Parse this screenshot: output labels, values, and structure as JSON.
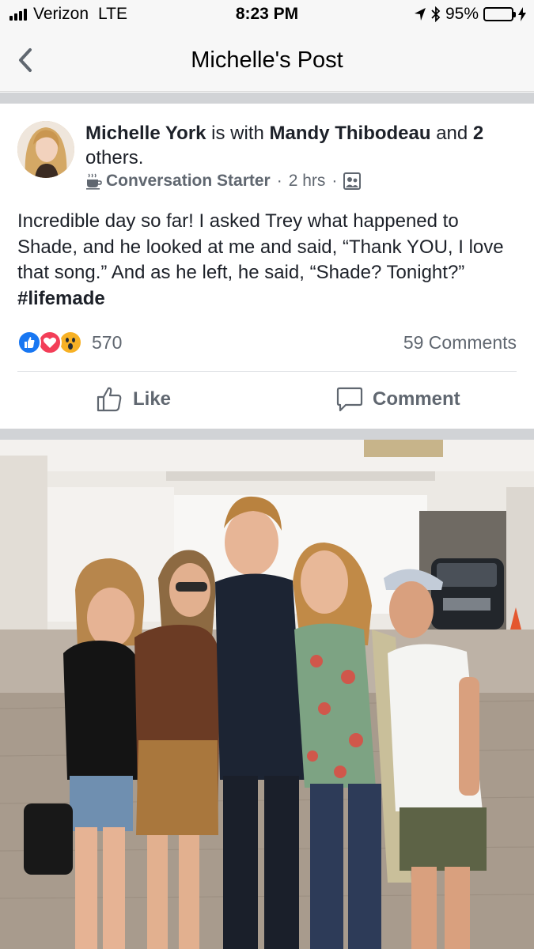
{
  "status_bar": {
    "carrier": "Verizon",
    "network": "LTE",
    "time": "8:23 PM",
    "battery_percent": "95%",
    "battery_level": 0.95,
    "icons": [
      "signal-icon",
      "location-arrow-icon",
      "bluetooth-icon",
      "battery-icon",
      "charging-bolt-icon"
    ]
  },
  "nav": {
    "title": "Michelle's Post",
    "back_icon": "chevron-left-icon"
  },
  "post": {
    "author": "Michelle York",
    "with_text": " is with ",
    "tagged": "Mandy Thibodeau",
    "and_text": " and ",
    "others_count": "2",
    "others_text": "others",
    "period": ".",
    "activity": "Conversation Starter",
    "activity_icon": "coffee-cup-icon",
    "time": "2 hrs",
    "privacy_icon": "friends-icon",
    "body": "Incredible day so far! I asked Trey what happened to Shade, and he looked at me and said, “Thank YOU, I love that song.” And as he left, he said, “Shade? Tonight?” ",
    "hashtag": "#lifemade",
    "reactions": {
      "types": [
        "like",
        "love",
        "wow"
      ],
      "count": "570"
    },
    "comments": "59 Comments",
    "actions": {
      "like": "Like",
      "comment": "Comment"
    }
  },
  "colors": {
    "like_blue": "#1877f2",
    "love_red": "#f33e58",
    "wow_yellow": "#f7b125",
    "text_primary": "#1d2129",
    "text_secondary": "#606770",
    "battery_green": "#4cd964"
  }
}
